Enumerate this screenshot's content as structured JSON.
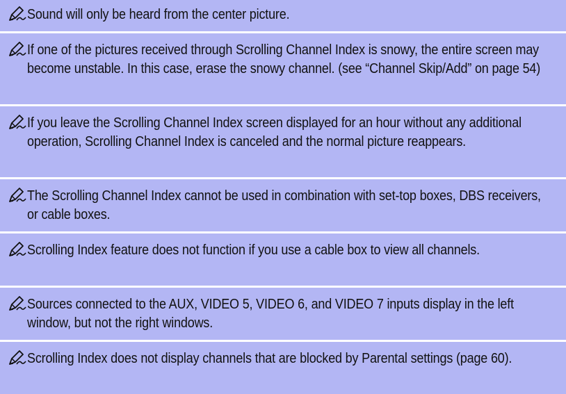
{
  "notes": [
    {
      "icon": "note-pencil-icon",
      "text": "Sound will only be heard from the center picture."
    },
    {
      "icon": "note-pencil-icon",
      "text": "If one of the pictures received through Scrolling Channel Index is snowy, the entire screen may become unstable. In this case, erase the snowy channel. (see “Channel Skip/Add” on page 54)"
    },
    {
      "icon": "note-pencil-icon",
      "text": "If you leave the Scrolling Channel Index screen displayed for an hour without any additional operation, Scrolling Channel Index is canceled and the normal picture reappears."
    },
    {
      "icon": "note-pencil-icon",
      "text": "The Scrolling Channel Index cannot be used in combination with set-top boxes, DBS receivers, or cable boxes."
    },
    {
      "icon": "note-pencil-icon",
      "text": "Scrolling Index feature does not function if you use a cable box to view all channels."
    },
    {
      "icon": "note-pencil-icon",
      "text": "Sources connected to the AUX, VIDEO 5, VIDEO 6, and VIDEO 7 inputs display in the left window, but not the right windows."
    },
    {
      "icon": "note-pencil-icon",
      "text": "Scrolling Index does not display channels that are blocked by Parental settings (page 60)."
    }
  ]
}
